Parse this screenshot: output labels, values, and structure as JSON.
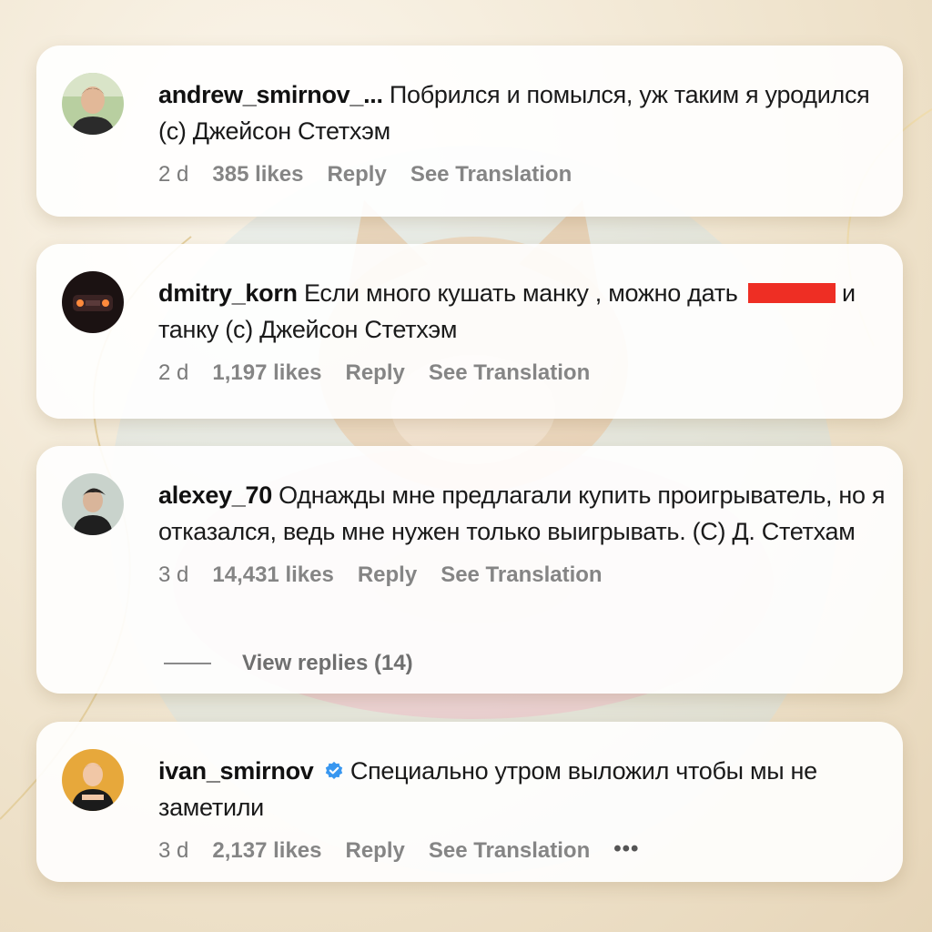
{
  "comments": [
    {
      "username": "andrew_smirnov_...",
      "text": "Побрился и помылся, уж таким я уродился (с) Джейсон Стетхэм",
      "time": "2 d",
      "likes": "385 likes",
      "reply_label": "Reply",
      "translate_label": "See Translation"
    },
    {
      "username": "dmitry_korn",
      "text_before": "Если много кушать манку , можно дать",
      "text_after": "и танку (с) Джейсон Стетхэм",
      "time": "2 d",
      "likes": "1,197 likes",
      "reply_label": "Reply",
      "translate_label": "See Translation"
    },
    {
      "username": "alexey_70",
      "text": "Однажды мне предлагали купить проигрыватель, но я отказался, ведь мне нужен только выигрывать. (С) Д. Стетхам",
      "time": "3 d",
      "likes": "14,431 likes",
      "reply_label": "Reply",
      "translate_label": "See Translation",
      "view_replies": "View replies (14)"
    },
    {
      "username": "ivan_smirnov",
      "verified": true,
      "text": "Специально утром выложил чтобы мы не заметили",
      "time": "3 d",
      "likes": "2,137 likes",
      "reply_label": "Reply",
      "translate_label": "See Translation",
      "more_label": "•••"
    }
  ],
  "colors": {
    "verified_badge": "#3897f0",
    "redaction": "#ee2e24",
    "meta_text": "#7a7a7a"
  }
}
